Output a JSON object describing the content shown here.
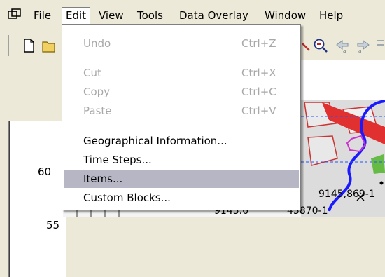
{
  "menubar": {
    "items": [
      {
        "label": "File"
      },
      {
        "label": "Edit"
      },
      {
        "label": "View"
      },
      {
        "label": "Tools"
      },
      {
        "label": "Data Overlay"
      },
      {
        "label": "Window"
      },
      {
        "label": "Help"
      }
    ]
  },
  "edit_menu": {
    "items": [
      {
        "label": "Undo",
        "shortcut": "Ctrl+Z",
        "enabled": false
      },
      {
        "label": "Cut",
        "shortcut": "Ctrl+X",
        "enabled": false
      },
      {
        "label": "Copy",
        "shortcut": "Ctrl+C",
        "enabled": false
      },
      {
        "label": "Paste",
        "shortcut": "Ctrl+V",
        "enabled": false
      },
      {
        "label": "Geographical Information...",
        "shortcut": "",
        "enabled": true
      },
      {
        "label": "Time Steps...",
        "shortcut": "",
        "enabled": true
      },
      {
        "label": "Items...",
        "shortcut": "",
        "enabled": true,
        "highlighted": true
      },
      {
        "label": "Custom Blocks...",
        "shortcut": "",
        "enabled": true
      }
    ]
  },
  "axis": {
    "labels": [
      "60",
      "55"
    ]
  },
  "map": {
    "labels": [
      "9145,869-1",
      "9143.6",
      "43870-1"
    ]
  },
  "colors": {
    "menu_highlight": "#b6b6c4",
    "disabled_text": "#a8a8a8",
    "road_red": "#e03030",
    "river_blue": "#1a1aff",
    "zone_magenta": "#cc33cc",
    "area_green": "#66bb44"
  },
  "icons": {
    "app": "window-icon",
    "toolbar": [
      "new-document-icon",
      "open-folder-icon",
      "zoom-out-icon",
      "pan-left-icon",
      "pan-right-icon"
    ]
  }
}
